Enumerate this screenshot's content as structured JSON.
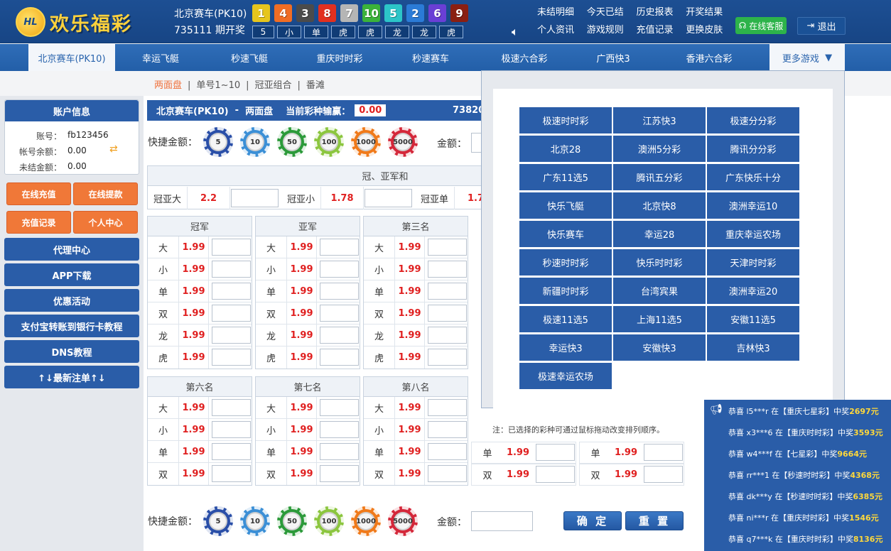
{
  "brand": {
    "logo_mark": "HL",
    "name": "欢乐福彩"
  },
  "lottery": {
    "name": "北京赛车(PK10)",
    "issue": "735111 期开奖",
    "balls": [
      {
        "n": "1",
        "c": "#e6c51d"
      },
      {
        "n": "4",
        "c": "#f06d24"
      },
      {
        "n": "3",
        "c": "#4b4b4b"
      },
      {
        "n": "8",
        "c": "#e2301f"
      },
      {
        "n": "7",
        "c": "#b5b5b5"
      },
      {
        "n": "10",
        "c": "#3bb23a"
      },
      {
        "n": "5",
        "c": "#2cc5c8"
      },
      {
        "n": "2",
        "c": "#2b7bd6"
      },
      {
        "n": "6",
        "c": "#6a3fd5"
      },
      {
        "n": "9",
        "c": "#8a1f12"
      }
    ],
    "subs": [
      "5",
      "小",
      "单",
      "虎",
      "虎",
      "龙",
      "龙",
      "虎"
    ]
  },
  "toplinks": [
    "未结明细",
    "今天已结",
    "历史报表",
    "开奖结果",
    "个人资讯",
    "游戏规则",
    "充值记录",
    "更换皮肤"
  ],
  "kefu": "在线客服",
  "logout": "退出",
  "nav": [
    "北京赛车(PK10)",
    "幸运飞艇",
    "秒速飞艇",
    "重庆时时彩",
    "秒速赛车",
    "极速六合彩",
    "广西快3",
    "香港六合彩"
  ],
  "more_games": "更多游戏",
  "subnav": {
    "active": "两面盘",
    "items": [
      "单号1~10",
      "冠亚组合",
      "番滩"
    ],
    "sep": "|"
  },
  "account": {
    "title": "账户信息",
    "rows": [
      {
        "label": "账号：",
        "value": "fb123456"
      },
      {
        "label": "帐号余额：",
        "value": "0.00"
      },
      {
        "label": "未结金额：",
        "value": "0.00"
      }
    ]
  },
  "side_buttons": {
    "recharge": "在线充值",
    "withdraw": "在线提款",
    "recharge_log": "充值记录",
    "personal": "个人中心",
    "items": [
      "代理中心",
      "APP下载",
      "优惠活动",
      "支付宝转账到银行卡教程",
      "DNS教程",
      "↑↓最新注单↑↓"
    ]
  },
  "titlebar": {
    "lottery": "北京赛车(PK10)",
    "sep": "-",
    "mode": "两面盘",
    "label": "当前彩种输赢：",
    "odd": "0.00",
    "issue_partial": "73820"
  },
  "quick": {
    "label": "快捷金额：",
    "chips": [
      {
        "v": "5",
        "c": "#2a4fa8"
      },
      {
        "v": "10",
        "c": "#3b8fd6"
      },
      {
        "v": "50",
        "c": "#2c9a3a"
      },
      {
        "v": "100",
        "c": "#8cc63f"
      },
      {
        "v": "1000",
        "c": "#f07a1a"
      },
      {
        "v": "5000",
        "c": "#d4283a"
      }
    ],
    "amount_label": "金额："
  },
  "gyh": {
    "title": "冠、亚军和",
    "cells": [
      {
        "k": "冠亚大",
        "o": "2.2"
      },
      {
        "k": "冠亚小",
        "o": "1.78"
      },
      {
        "k": "冠亚单",
        "o": "1.7"
      }
    ]
  },
  "groups_row1": [
    {
      "title": "冠军",
      "rows": [
        {
          "k": "大",
          "o": "1.99"
        },
        {
          "k": "小",
          "o": "1.99"
        },
        {
          "k": "单",
          "o": "1.99"
        },
        {
          "k": "双",
          "o": "1.99"
        },
        {
          "k": "龙",
          "o": "1.99"
        },
        {
          "k": "虎",
          "o": "1.99"
        }
      ]
    },
    {
      "title": "亚军",
      "rows": [
        {
          "k": "大",
          "o": "1.99"
        },
        {
          "k": "小",
          "o": "1.99"
        },
        {
          "k": "单",
          "o": "1.99"
        },
        {
          "k": "双",
          "o": "1.99"
        },
        {
          "k": "龙",
          "o": "1.99"
        },
        {
          "k": "虎",
          "o": "1.99"
        }
      ]
    },
    {
      "title": "第三名",
      "rows": [
        {
          "k": "大",
          "o": "1.99"
        },
        {
          "k": "小",
          "o": "1.99"
        },
        {
          "k": "单",
          "o": "1.99"
        },
        {
          "k": "双",
          "o": "1.99"
        },
        {
          "k": "龙",
          "o": "1.99"
        },
        {
          "k": "虎",
          "o": "1.99"
        }
      ]
    }
  ],
  "groups_row2": [
    {
      "title": "第六名",
      "rows": [
        {
          "k": "大",
          "o": "1.99"
        },
        {
          "k": "小",
          "o": "1.99"
        },
        {
          "k": "单",
          "o": "1.99"
        },
        {
          "k": "双",
          "o": "1.99"
        }
      ]
    },
    {
      "title": "第七名",
      "rows": [
        {
          "k": "大",
          "o": "1.99"
        },
        {
          "k": "小",
          "o": "1.99"
        },
        {
          "k": "单",
          "o": "1.99"
        },
        {
          "k": "双",
          "o": "1.99"
        }
      ]
    },
    {
      "title": "第八名",
      "rows": [
        {
          "k": "大",
          "o": "1.99"
        },
        {
          "k": "小",
          "o": "1.99"
        },
        {
          "k": "单",
          "o": "1.99"
        },
        {
          "k": "双",
          "o": "1.99"
        }
      ]
    }
  ],
  "ghost_rows": [
    {
      "k": "单",
      "o": "1.99"
    },
    {
      "k": "双",
      "o": "1.99"
    },
    {
      "k": "单",
      "o": "1.99"
    },
    {
      "k": "双",
      "o": "1.99"
    }
  ],
  "confirm": "确 定",
  "reset": "重 置",
  "dropdown": {
    "items": [
      "极速时时彩",
      "江苏快3",
      "极速分分彩",
      "北京28",
      "澳洲5分彩",
      "腾讯分分彩",
      "广东11选5",
      "腾讯五分彩",
      "广东快乐十分",
      "快乐飞艇",
      "北京快8",
      "澳洲幸运10",
      "快乐赛车",
      "幸运28",
      "重庆幸运农场",
      "秒速时时彩",
      "快乐时时彩",
      "天津时时彩",
      "新疆时时彩",
      "台湾宾果",
      "澳洲幸运20",
      "极速11选5",
      "上海11选5",
      "安徽11选5",
      "幸运快3",
      "安徽快3",
      "吉林快3",
      "极速幸运农场"
    ],
    "note": "注：已选择的彩种可通过鼠标拖动改变排列顺序。"
  },
  "winners": [
    {
      "pre": "恭喜 l5***r 在【重庆七星彩】中奖",
      "amt": "2697元"
    },
    {
      "pre": "恭喜 x3***6 在【重庆时时彩】中奖",
      "amt": "3593元"
    },
    {
      "pre": "恭喜 w4***f 在【七星彩】中奖",
      "amt": "9664元"
    },
    {
      "pre": "恭喜 rr***1 在【秒速时时彩】中奖",
      "amt": "4368元"
    },
    {
      "pre": "恭喜 dk***y 在【秒速时时彩】中奖",
      "amt": "6385元"
    },
    {
      "pre": "恭喜 ni***r 在【重庆时时彩】中奖",
      "amt": "1546元"
    },
    {
      "pre": "恭喜 q7***k 在【重庆时时彩】中奖",
      "amt": "8136元"
    }
  ]
}
